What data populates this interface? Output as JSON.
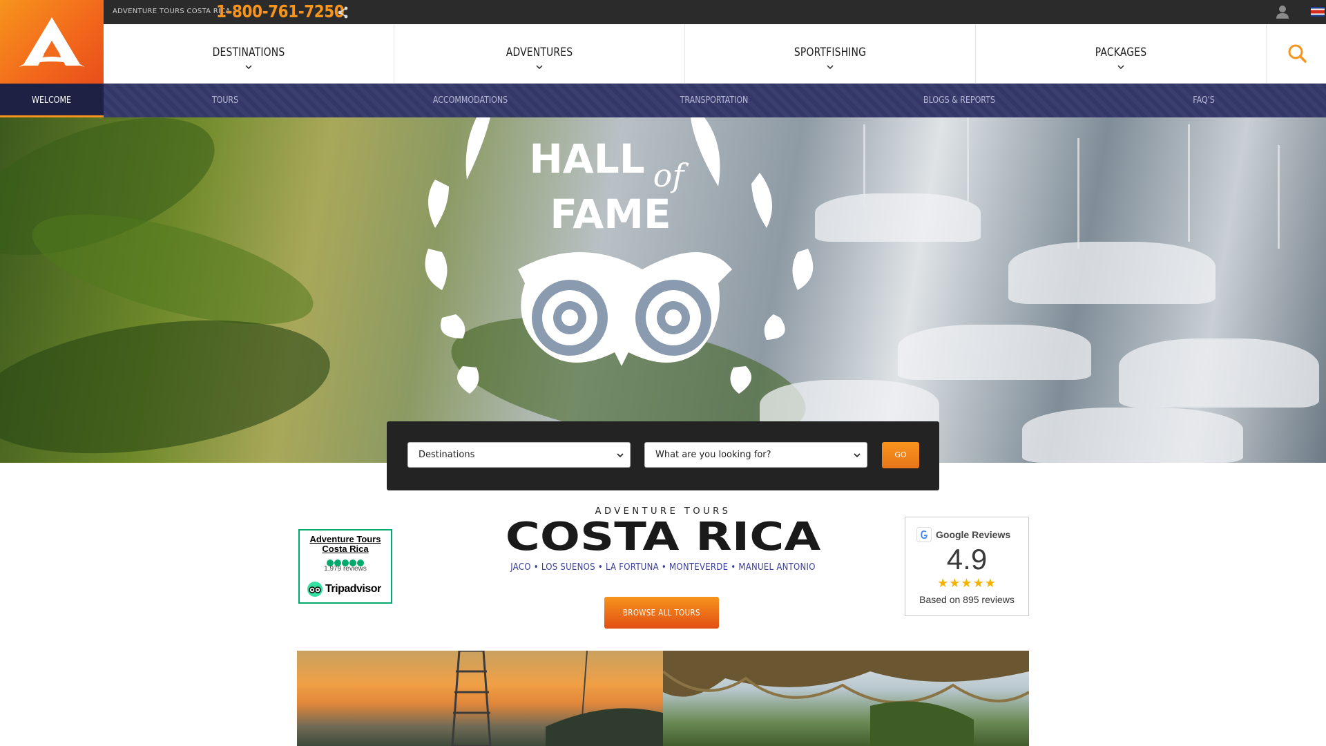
{
  "topbar": {
    "brand": "ADVENTURE TOURS COSTA RICA -",
    "phone": "1-800-761-7250",
    "share_icon": "share-icon",
    "user_icon": "user-icon",
    "flag_icon": "flag-icon"
  },
  "main_nav": [
    {
      "label": "DESTINATIONS",
      "has_dropdown": true
    },
    {
      "label": "ADVENTURES",
      "has_dropdown": true
    },
    {
      "label": "SPORTFISHING",
      "has_dropdown": true
    },
    {
      "label": "PACKAGES",
      "has_dropdown": true
    }
  ],
  "sub_nav": [
    {
      "label": "WELCOME",
      "active": true
    },
    {
      "label": "TOURS"
    },
    {
      "label": "ACCOMMODATIONS"
    },
    {
      "label": "TRANSPORTATION"
    },
    {
      "label": "BLOGS & REPORTS"
    },
    {
      "label": "FAQ'S"
    }
  ],
  "hero": {
    "badge_line1": "HALL",
    "badge_of": "of",
    "badge_line2": "FAME"
  },
  "search": {
    "destinations": "Destinations",
    "looking_for": "What are you looking for?",
    "go_label": "GO"
  },
  "tripadvisor": {
    "name": "Adventure Tours Costa Rica",
    "rating_dots": 5,
    "reviews": "1,979 reviews",
    "brand": "Tripadvisor"
  },
  "center": {
    "eyebrow": "ADVENTURE TOURS",
    "title": "COSTA RICA",
    "places": "JACO • LOS SUENOS • LA FORTUNA • MONTEVERDE • MANUEL ANTONIO",
    "browse_label": "BROWSE ALL TOURS"
  },
  "google": {
    "label": "Google Reviews",
    "score": "4.9",
    "stars": 5,
    "based_on": "Based on 895 reviews"
  },
  "colors": {
    "accent": "#f7941d",
    "subnav": "#35396a",
    "places_text": "#3a3f97",
    "tripadvisor_green": "#00aa6c"
  }
}
